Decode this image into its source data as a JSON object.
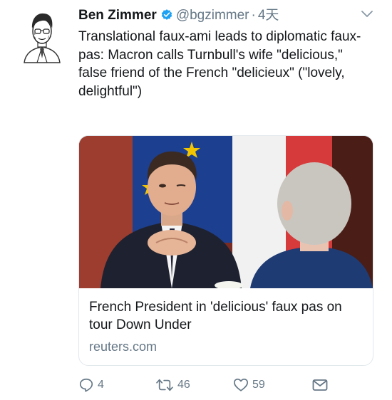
{
  "tweet": {
    "author_name": "Ben Zimmer",
    "handle": "@bgzimmer",
    "separator": "·",
    "time": "4天",
    "text": "Translational faux-ami leads to diplomatic faux-pas: Macron calls Turnbull's wife \"delicious,\" false friend of the French \"delicieux\" (\"lovely, delightful\")"
  },
  "card": {
    "title": "French President in 'delicious' faux pas on tour Down Under",
    "domain": "reuters.com",
    "image_icon": "news-photo"
  },
  "actions": {
    "reply_count": "4",
    "retweet_count": "46",
    "like_count": "59"
  },
  "icons": {
    "verified": "verified-badge-icon",
    "caret": "chevron-down-icon",
    "reply": "reply-icon",
    "retweet": "retweet-icon",
    "like": "heart-icon",
    "dm": "envelope-icon"
  },
  "colors": {
    "verified": "#1da1f2",
    "secondary_text": "#657786",
    "primary_text": "#14171a",
    "card_border": "#e1e8ed"
  }
}
